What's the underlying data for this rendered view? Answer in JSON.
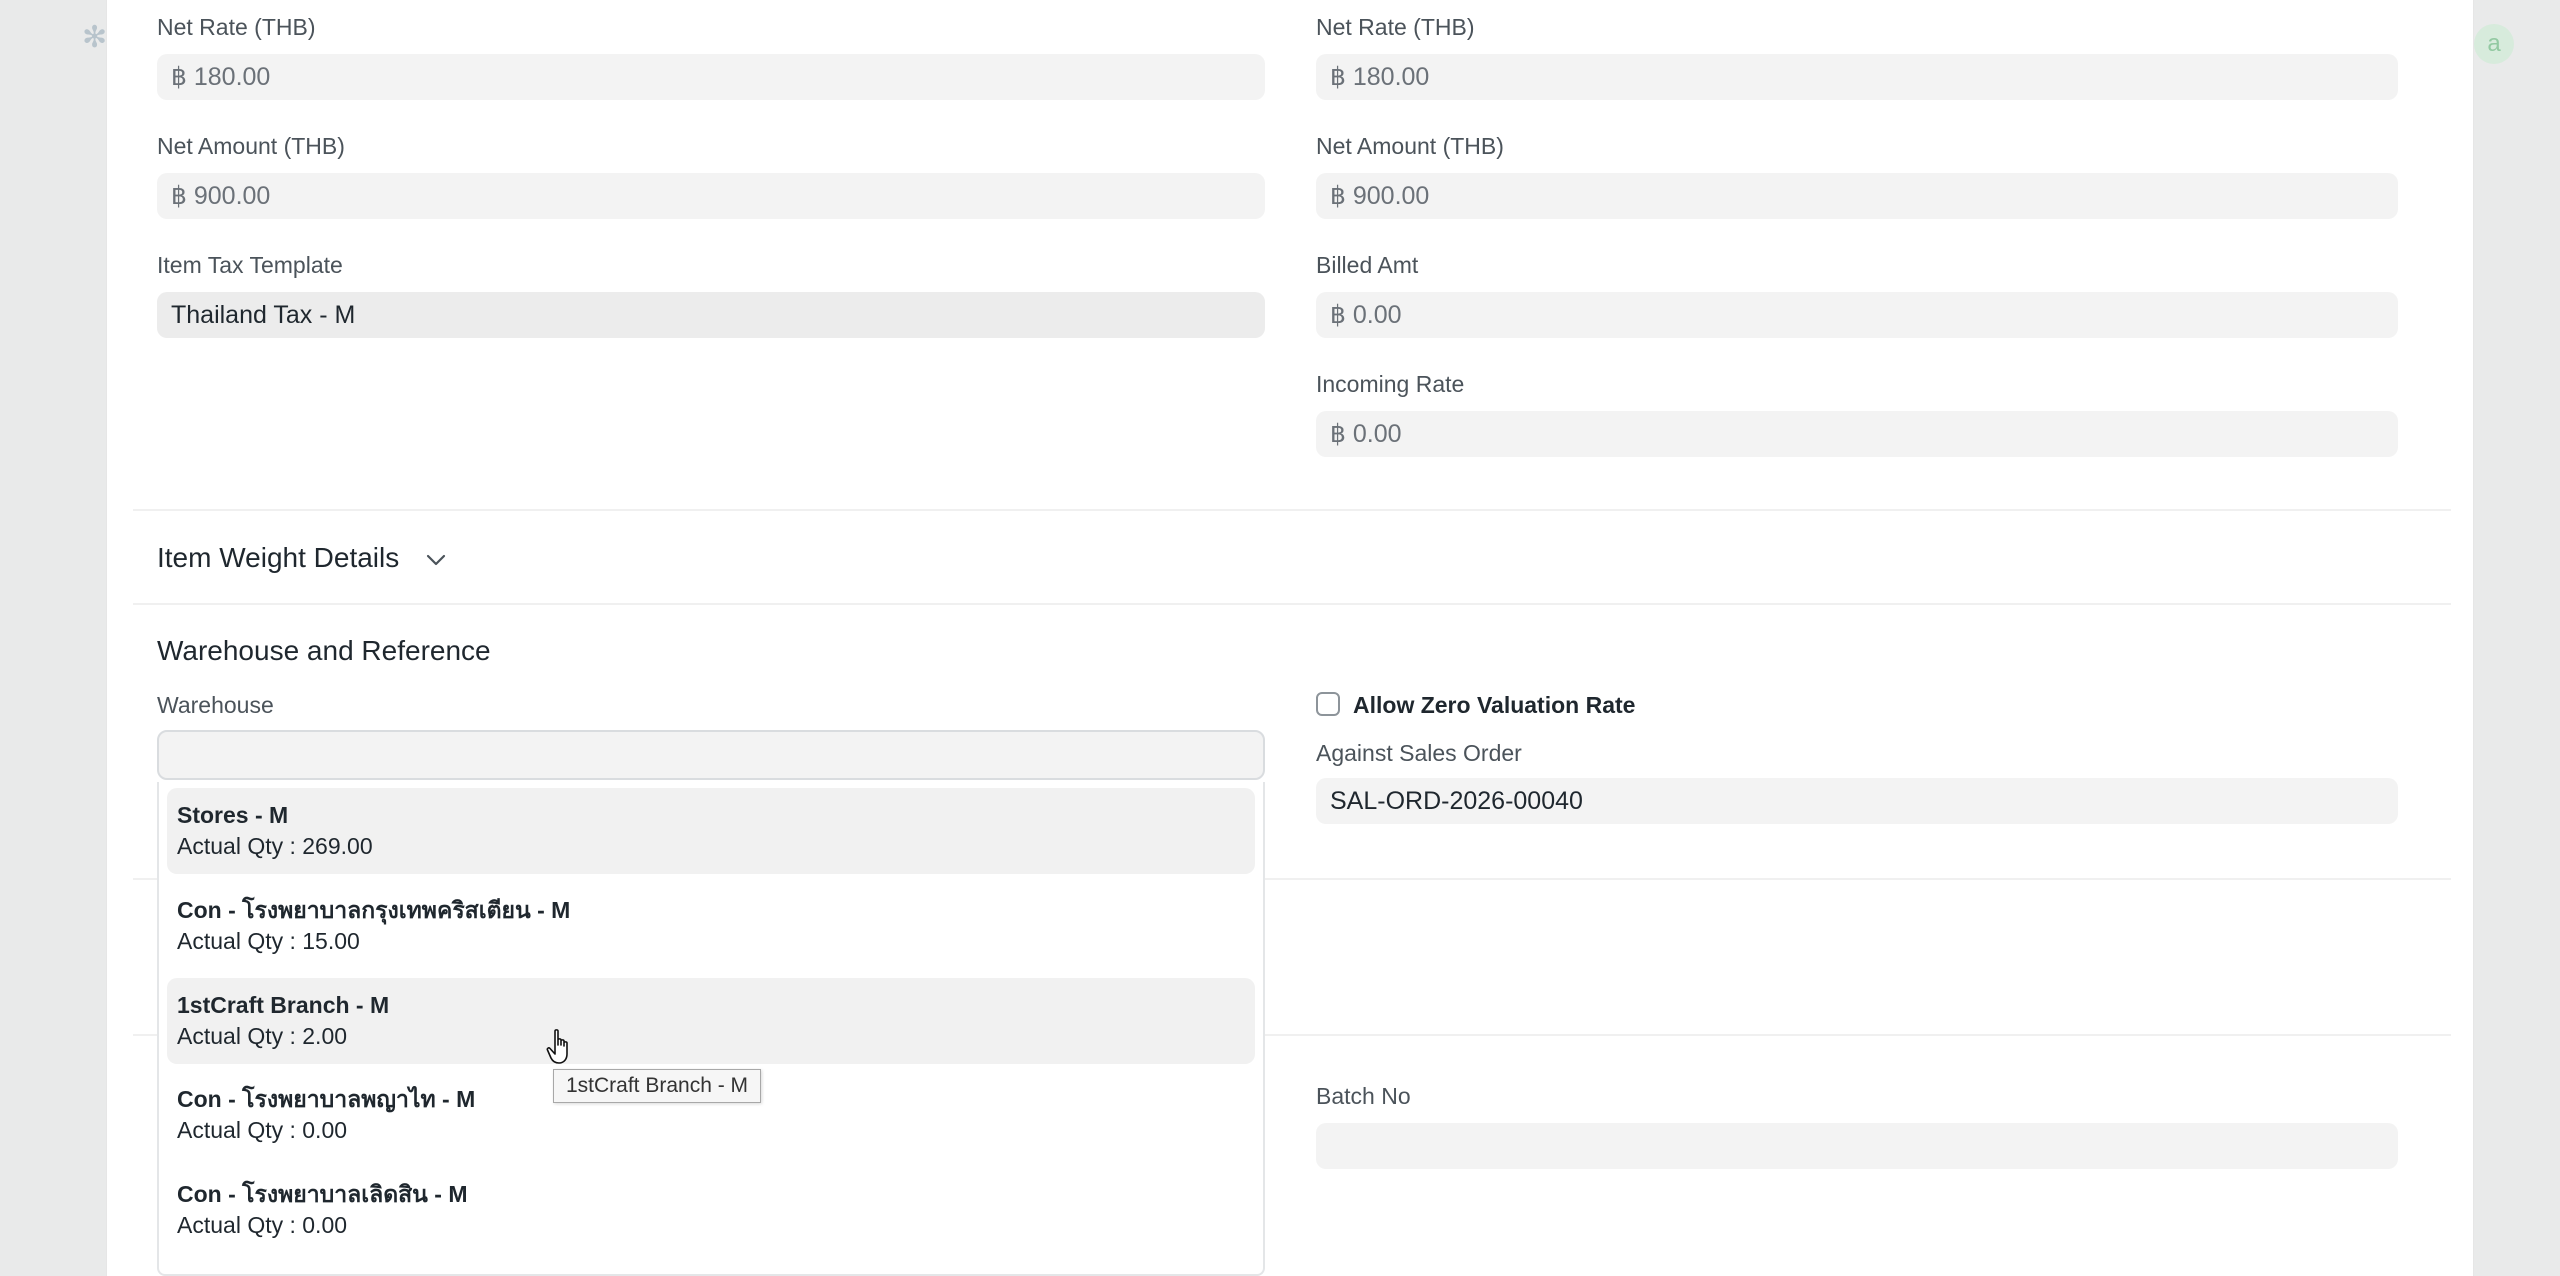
{
  "backdrop": {
    "avatar_letter": "a"
  },
  "left_column": {
    "net_rate": {
      "label": "Net Rate (THB)",
      "value": "฿ 180.00"
    },
    "net_amount": {
      "label": "Net Amount (THB)",
      "value": "฿ 900.00"
    },
    "item_tax_template": {
      "label": "Item Tax Template",
      "value": "Thailand Tax - M"
    }
  },
  "right_column": {
    "net_rate": {
      "label": "Net Rate (THB)",
      "value": "฿ 180.00"
    },
    "net_amount": {
      "label": "Net Amount (THB)",
      "value": "฿ 900.00"
    },
    "billed_amt": {
      "label": "Billed Amt",
      "value": "฿ 0.00"
    },
    "incoming_rate": {
      "label": "Incoming Rate",
      "value": "฿ 0.00"
    }
  },
  "item_weight_section": {
    "title": "Item Weight Details"
  },
  "warehouse_section": {
    "title": "Warehouse and Reference",
    "warehouse_label": "Warehouse",
    "warehouse_value": "",
    "allow_zero_valuation_label": "Allow Zero Valuation Rate",
    "allow_zero_valuation_checked": false,
    "against_sales_order_label": "Against Sales Order",
    "against_sales_order_value": "SAL-ORD-2026-00040"
  },
  "batch": {
    "label": "Batch No",
    "value": ""
  },
  "warehouse_dropdown": {
    "items": [
      {
        "title": "Stores - M",
        "subtitle": "Actual Qty : 269.00"
      },
      {
        "title": "Con - โรงพยาบาลกรุงเทพคริสเตียน - M",
        "subtitle": "Actual Qty : 15.00"
      },
      {
        "title": "1stCraft Branch - M",
        "subtitle": "Actual Qty : 2.00"
      },
      {
        "title": "Con - โรงพยาบาลพญาไท - M",
        "subtitle": "Actual Qty : 0.00"
      },
      {
        "title": "Con - โรงพยาบาลเลิดสิน - M",
        "subtitle": "Actual Qty : 0.00"
      }
    ]
  },
  "tooltip": {
    "text": "1stCraft Branch - M"
  }
}
